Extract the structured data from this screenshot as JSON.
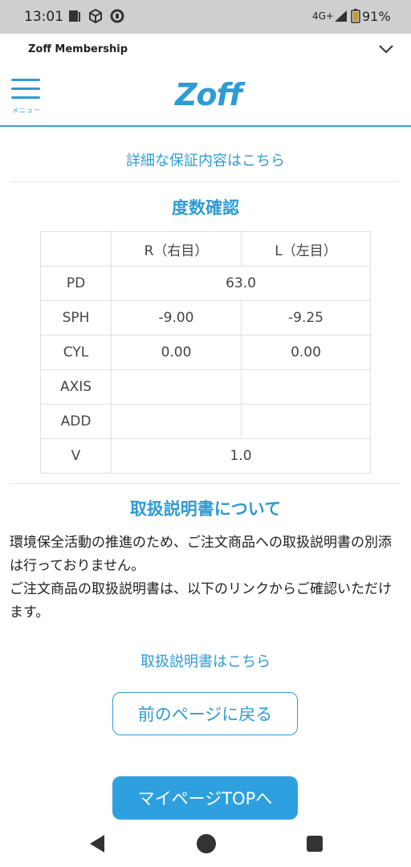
{
  "status_bar": {
    "time": "13:01",
    "network": "4G+",
    "battery": "91%",
    "icons": [
      "notification-icon",
      "package-icon",
      "sync-icon",
      "signal-icon",
      "battery-icon"
    ]
  },
  "membership": {
    "title": "Zoff Membership",
    "chevron_icon": "chevron-down-icon"
  },
  "header": {
    "menu_label": "メニュー",
    "logo": "Zoff",
    "accent_color": "#2e9bd6"
  },
  "warranty_link": "詳細な保証内容はこちら",
  "prescription": {
    "title": "度数確認",
    "columns": [
      "",
      "R（右目）",
      "L（左目）"
    ],
    "rows": [
      {
        "label": "PD",
        "value": "63.0"
      },
      {
        "label": "SPH",
        "r": "-9.00",
        "l": "-9.25"
      },
      {
        "label": "CYL",
        "r": "0.00",
        "l": "0.00"
      },
      {
        "label": "AXIS",
        "r": "",
        "l": ""
      },
      {
        "label": "ADD",
        "r": "",
        "l": ""
      },
      {
        "label": "V",
        "value": "1.0"
      }
    ]
  },
  "manual": {
    "title": "取扱説明書について",
    "paragraph1": "環境保全活動の推進のため、ご注文商品への取扱説明書の別添は行っておりません。",
    "paragraph2": "ご注文商品の取扱説明書は、以下のリンクからご確認いただけます。",
    "link": "取扱説明書はこちら"
  },
  "buttons": {
    "back": "前のページに戻る",
    "mypage": "マイページTOPへ"
  },
  "nav_bar": {
    "icons": [
      "back-triangle-icon",
      "home-circle-icon",
      "recent-square-icon"
    ]
  }
}
